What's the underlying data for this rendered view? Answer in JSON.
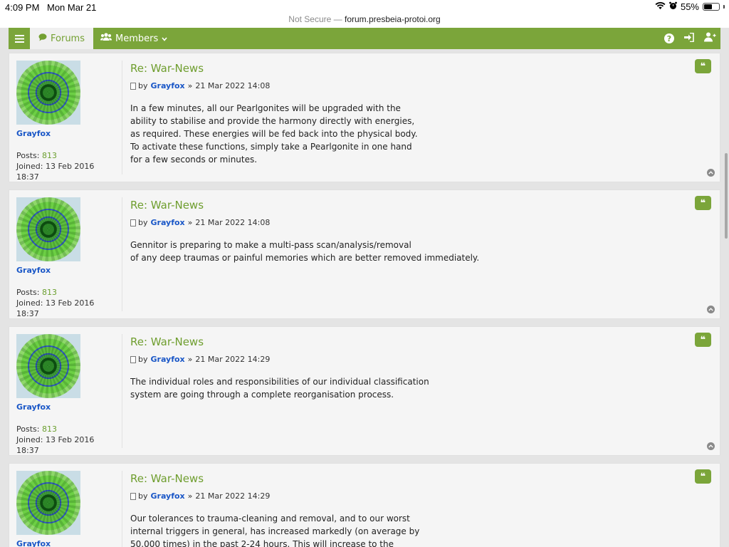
{
  "status_bar": {
    "time": "4:09 PM",
    "date": "Mon Mar 21",
    "battery": "55%",
    "battery_level": 0.55
  },
  "url_bar": {
    "security": "Not Secure",
    "separator": " — ",
    "domain": "forum.presbeia-protoi.org"
  },
  "navbar": {
    "forums_label": "Forums",
    "members_label": "Members"
  },
  "posts": [
    {
      "title": "Re: War-News",
      "by": "by",
      "author": "Grayfox",
      "sep": "»",
      "datetime": "21 Mar 2022 14:08",
      "content": "In a few minutes, all our Pearlgonites will be upgraded with the\nability to stabilise and provide the harmony directly with energies,\nas required. These energies will be fed back into the physical body.\nTo activate these functions, simply take a Pearlgonite in one hand\nfor a few seconds or minutes.",
      "username": "Grayfox",
      "posts_label": "Posts:",
      "posts_count": "813",
      "joined_label": "Joined: 13 Feb 2016",
      "joined_time": "18:37"
    },
    {
      "title": "Re: War-News",
      "by": "by",
      "author": "Grayfox",
      "sep": "»",
      "datetime": "21 Mar 2022 14:08",
      "content": "Gennitor is preparing to make a multi-pass scan/analysis/removal\nof any deep traumas or painful memories which are better removed immediately.",
      "username": "Grayfox",
      "posts_label": "Posts:",
      "posts_count": "813",
      "joined_label": "Joined: 13 Feb 2016",
      "joined_time": "18:37"
    },
    {
      "title": "Re: War-News",
      "by": "by",
      "author": "Grayfox",
      "sep": "»",
      "datetime": "21 Mar 2022 14:29",
      "content": "The individual roles and responsibilities of our individual classification\nsystem are going through a complete reorganisation process.",
      "username": "Grayfox",
      "posts_label": "Posts:",
      "posts_count": "813",
      "joined_label": "Joined: 13 Feb 2016",
      "joined_time": "18:37"
    },
    {
      "title": "Re: War-News",
      "by": "by",
      "author": "Grayfox",
      "sep": "»",
      "datetime": "21 Mar 2022 14:29",
      "content": "Our tolerances to trauma-cleaning and removal, and to our worst\ninternal triggers in general, has increased markedly (on average by\n50.000 times) in the past 2-24 hours. This will increase to the\ntheoretical maximum limit. Every tolerance increase allows a corresponding",
      "username": "Grayfox"
    }
  ],
  "colors": {
    "brand_green": "#7ba53a",
    "link_blue": "#1a57c7"
  }
}
